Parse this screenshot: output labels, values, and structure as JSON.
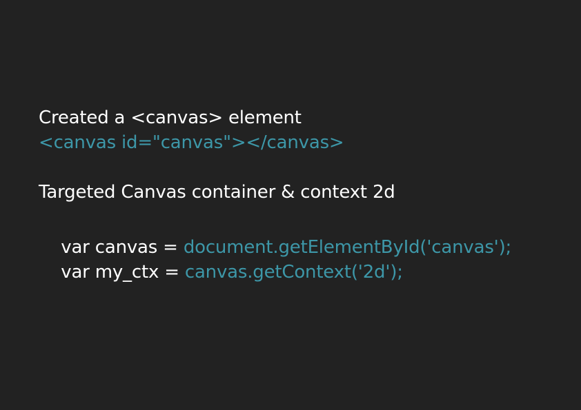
{
  "colors": {
    "background": "#222222",
    "text": "#ffffff",
    "code_accent": "#3d97a8"
  },
  "step1": {
    "heading": "Created a <canvas> element",
    "code": "<canvas id=\"canvas\"></canvas>"
  },
  "step2": {
    "heading": "Targeted Canvas container & context 2d",
    "line1_prefix": "var canvas = ",
    "line1_code": "document.getElementById('canvas');",
    "line2_prefix": "var my_ctx = ",
    "line2_code": "canvas.getContext('2d');"
  }
}
